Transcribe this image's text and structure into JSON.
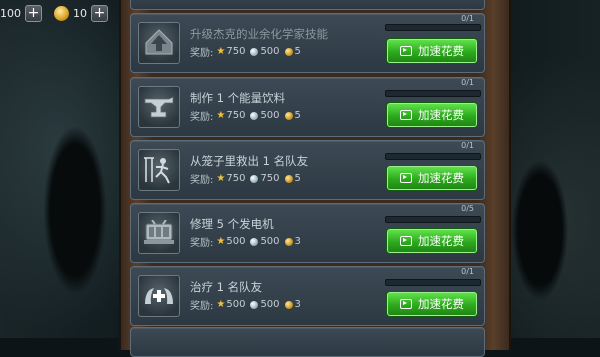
{
  "currency": {
    "cash_value": "100",
    "gold_value": "10"
  },
  "tasks": [
    {
      "title": "升级杰克的业余化学家技能",
      "reward_label": "奖励:",
      "xp": "750",
      "orbs": "500",
      "coins": "5",
      "progress": "0/1",
      "button": "加速花费",
      "icon": "upgrade-arrow-icon"
    },
    {
      "title": "制作 1 个能量饮料",
      "reward_label": "奖励:",
      "xp": "750",
      "orbs": "500",
      "coins": "5",
      "progress": "0/1",
      "button": "加速花费",
      "icon": "anvil-icon"
    },
    {
      "title": "从笼子里救出 1 名队友",
      "reward_label": "奖励:",
      "xp": "750",
      "orbs": "750",
      "coins": "5",
      "progress": "0/1",
      "button": "加速花费",
      "icon": "rescue-icon"
    },
    {
      "title": "修理 5 个发电机",
      "reward_label": "奖励:",
      "xp": "500",
      "orbs": "500",
      "coins": "3",
      "progress": "0/5",
      "button": "加速花费",
      "icon": "generator-icon"
    },
    {
      "title": "治疗 1 名队友",
      "reward_label": "奖励:",
      "xp": "500",
      "orbs": "500",
      "coins": "3",
      "progress": "0/1",
      "button": "加速花费",
      "icon": "heal-icon"
    }
  ]
}
